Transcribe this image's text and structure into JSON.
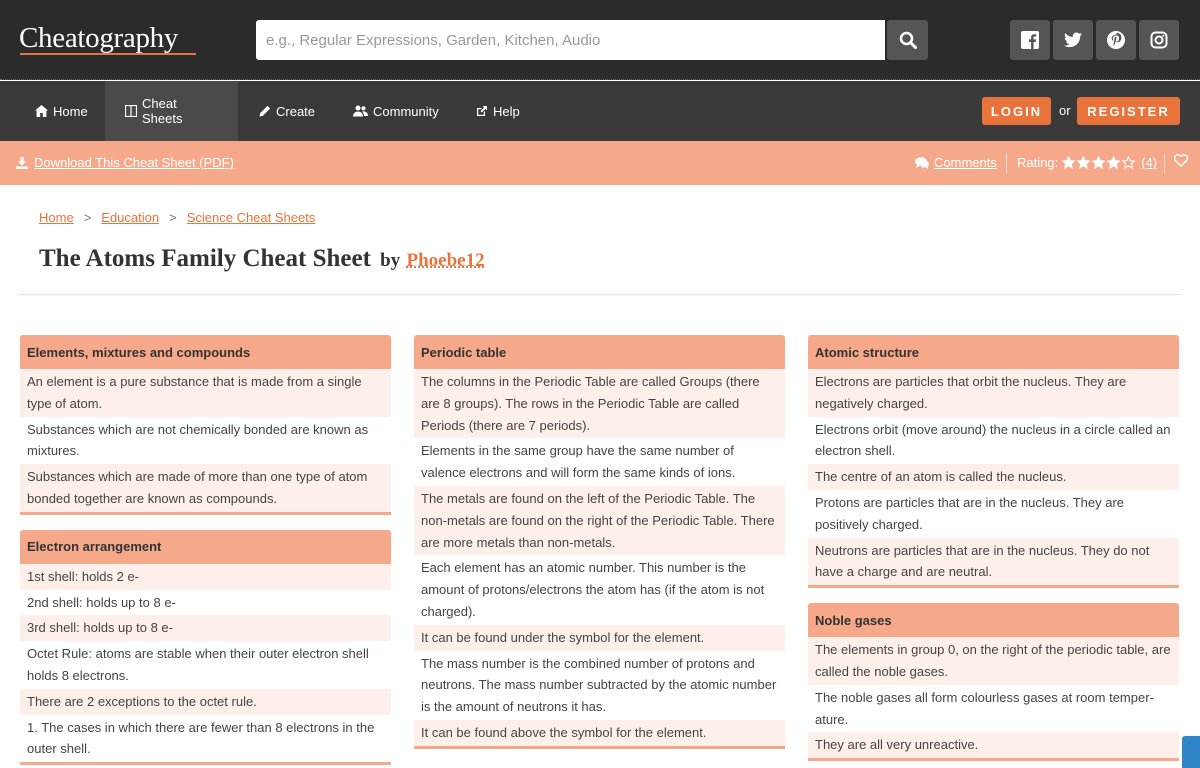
{
  "header": {
    "logo": "Cheatography",
    "search_placeholder": "e.g., Regular Expressions, Garden, Kitchen, Audio",
    "search_icon": "search-icon",
    "social_icons": [
      "facebook-icon",
      "twitter-icon",
      "pinterest-icon",
      "instagram-icon"
    ]
  },
  "nav": {
    "items": [
      {
        "label": "Home",
        "icon": "home-icon"
      },
      {
        "label": "Cheat Sheets",
        "icon": "book-icon"
      },
      {
        "label": "Create",
        "icon": "pencil-icon"
      },
      {
        "label": "Community",
        "icon": "users-icon"
      },
      {
        "label": "Help",
        "icon": "external-link-icon"
      }
    ],
    "login": "LOGIN",
    "or": "or",
    "register": "REGISTER"
  },
  "actions": {
    "download": "Download This Cheat Sheet (PDF)",
    "comments": "Comments",
    "rating_label": "Rating:",
    "rating_stars": 4,
    "rating_max": 5,
    "rating_count": "(4)"
  },
  "breadcrumb": [
    "Home",
    "Education",
    "Science Cheat Sheets"
  ],
  "title": {
    "main": "The Atoms Family Cheat Sheet",
    "by": "by",
    "author": "Phoebe12"
  },
  "columns": [
    {
      "boxes": [
        {
          "title": "Elements, mixtures and compounds",
          "rows": [
            "An element is a pure substance that is made from a single type of atom.",
            "Substances which are not chemically bonded are known as mixtures.",
            "Substances which are made of more than one type of atom bonded together are known as compounds."
          ]
        },
        {
          "title": "Electron arrangement",
          "rows": [
            "1st shell: holds 2 e-",
            "2nd shell: holds up to 8 e-",
            "3rd shell: holds up to 8 e-",
            "Octet Rule: atoms are stable when their outer electron shell holds 8 electrons.",
            "There are 2 exceptions to the octet rule.",
            "1. The cases in which there are fewer than 8 electrons in the outer shell."
          ]
        }
      ]
    },
    {
      "boxes": [
        {
          "title": "Periodic table",
          "rows": [
            "The columns in the Periodic Table are called Groups (there are 8 groups). The rows in the Periodic Table are called Periods (there are 7 periods).",
            "Elements in the same group have the same number of valence electrons and will form the same kinds of ions.",
            "The metals are found on the left of the Periodic Table. The non-metals are found on the right of the Periodic Table. There are more metals than non-metals.",
            "Each element has an atomic number. This number is the amount of protons/electrons the atom has (if the atom is not charged).",
            "It can be found under the symbol for the element.",
            "The mass number is the combined number of protons and neutrons. The mass number subtracted by the atomic number is the amount of neutrons it has.",
            "It can be found above the symbol for the element."
          ]
        }
      ]
    },
    {
      "boxes": [
        {
          "title": "Atomic structure",
          "rows": [
            "Electrons are particles that orbit the nucleus. They are negatively charged.",
            "Electrons orbit (move around) the nucleus in a circle called an electron shell.",
            "The centre of an atom is called the nucleus.",
            "Protons are particles that are in the nucleus. They are positively charged.",
            "Neutrons are particles that are in the nucleus. They do not have a charge and are neutral."
          ]
        },
        {
          "title": "Noble gases",
          "rows": [
            "The elements in group 0, on the right of the periodic table, are called the noble gases.",
            "The noble gases all form colourless gases at room temper­ature.",
            "They are all very unreactive."
          ]
        }
      ]
    }
  ],
  "colors": {
    "accent": "#e8743b",
    "header_bg": "#2b2b2b",
    "nav_bg": "#3a3a3a",
    "salmon": "#f5a98a",
    "row_tint": "#fdf0ea"
  }
}
